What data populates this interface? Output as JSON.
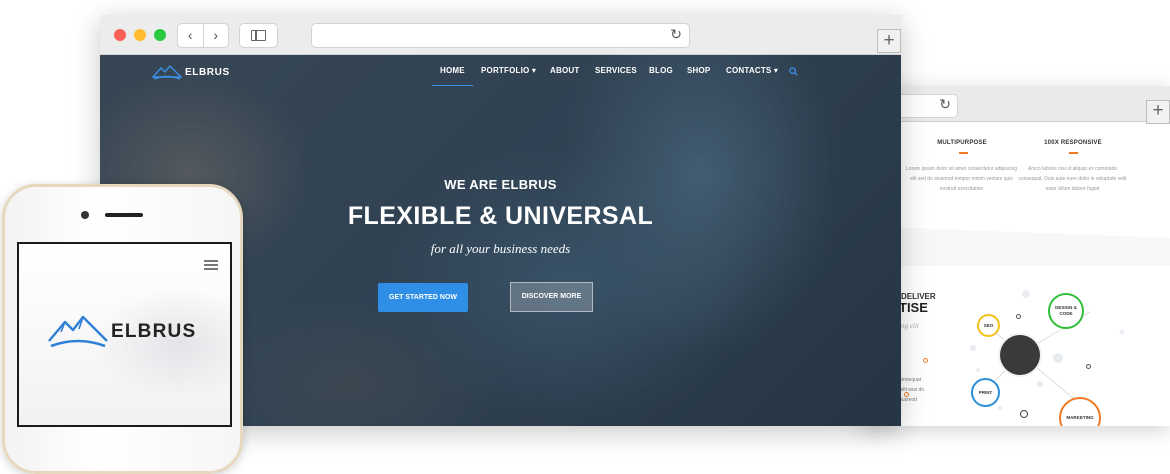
{
  "main_browser": {
    "nav": [
      {
        "label": "HOME",
        "active": true
      },
      {
        "label": "PORTFOLIO ▾"
      },
      {
        "label": "ABOUT"
      },
      {
        "label": "SERVICES"
      },
      {
        "label": "BLOG"
      },
      {
        "label": "SHOP"
      },
      {
        "label": "CONTACTS ▾"
      }
    ],
    "brand": "ELBRUS",
    "hero": {
      "subtitle": "WE ARE ELBRUS",
      "title": "FLEXIBLE & UNIVERSAL",
      "tagline": "for all your business needs",
      "primary_button": "GET STARTED NOW",
      "secondary_button": "DISCOVER MORE"
    },
    "colors": {
      "accent": "#2f8fe6",
      "close": "#fe5f57",
      "minimize": "#febc2e",
      "zoom": "#28c840"
    },
    "icons": [
      "back-icon",
      "forward-icon",
      "sidebar-icon",
      "reload-icon",
      "new-tab-icon",
      "search-icon"
    ]
  },
  "back_browser": {
    "features": [
      {
        "title": "MULTIPURPOSE",
        "text": "Lorem ipsum dolor sit amet consectetur adipiscing elit sed do eiusmod tempor minim veniam quis nostrud exercitation"
      },
      {
        "title": "100X RESPONSIVE",
        "text": "Amco laboris nisi ut aliquip ex commodo consequat. Duis aute irure dolor in voluptate velit esse cillum dolore fugiat"
      }
    ],
    "section": {
      "kicker": "DELIVER",
      "title": "TISE",
      "tagline": "ying elit",
      "text": "consequat velit essi do eiusmod"
    },
    "diagram_nodes": [
      "SEO",
      "DESIGN & CODE",
      "PRINT",
      "MARKETING"
    ],
    "colors": {
      "orange": "#f07b24",
      "green": "#2fbf3a",
      "yellow": "#f3c21a",
      "blue": "#2a8fd6"
    }
  },
  "phone": {
    "brand": "ELBRUS"
  }
}
